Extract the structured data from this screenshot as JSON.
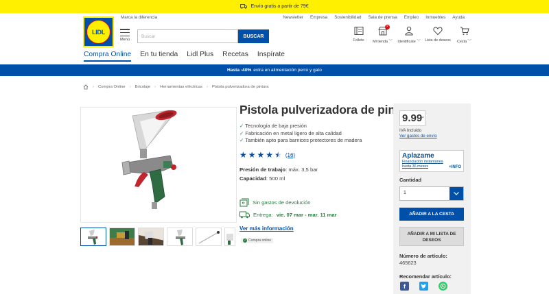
{
  "topbar": {
    "text": "Envío gratis a partir de 79€"
  },
  "utility": {
    "left": "Marca la diferencia",
    "links": [
      "Newsletter",
      "Empresa",
      "Sostenibilidad",
      "Sala de prensa",
      "Empleo",
      "Inmuebles",
      "Ayuda"
    ]
  },
  "logo": {
    "text": "LIDL"
  },
  "menu": {
    "label": "Menú"
  },
  "search": {
    "placeholder": "Buscar",
    "button": "BUSCAR"
  },
  "header_icons": [
    {
      "icon": "folleto-icon",
      "label": "Folleto"
    },
    {
      "icon": "shop-icon",
      "label": "Mi tienda",
      "chevron": true
    },
    {
      "icon": "user-icon",
      "label": "Identifícate",
      "chevron": true
    },
    {
      "icon": "heart-icon",
      "label": "Lista de deseos"
    },
    {
      "icon": "cart-icon",
      "label": "Cesta",
      "chevron": true
    }
  ],
  "nav": [
    "Compra Online",
    "En tu tienda",
    "Lidl Plus",
    "Recetas",
    "Inspírate"
  ],
  "promo": {
    "bold": "Hasta -40%",
    "rest": "extra en alimentación perro y gato"
  },
  "breadcrumbs": [
    "Compra Online",
    "Bricolaje",
    "Herramientas eléctricas",
    "Pistola pulverizadora de pintura"
  ],
  "product": {
    "title": "Pistola pulverizadora de pintura",
    "features": [
      "Tecnología de baja presión",
      "Fabricación en metal ligero de alta calidad",
      "También apto para barnices protectores de madera"
    ],
    "rating_count": "(16)",
    "rating_stars": 4.5,
    "spec1_label": "Presión de trabajo",
    "spec1_value": ": máx. 3,5 bar",
    "spec2_label": "Capacidad",
    "spec2_value": ": 500 ml",
    "returns": "Sin gastos de devolución",
    "delivery_label": "Entrega:",
    "delivery_dates": "vie. 07 mar - mar. 11 mar",
    "more_info": "Ver más información",
    "online_badge": "Compra online"
  },
  "buy": {
    "price": "9.99",
    "price_mark": "*",
    "iva": "IVA Incluido",
    "envio": "Ver gastos de envío",
    "aplazame_brand": "Aplazame",
    "aplazame_text": "Financiación instantánea hasta 36 meses",
    "aplazame_info": "+INFO",
    "qty_label": "Cantidad",
    "qty_value": "1",
    "add_cart": "AÑADIR A LA CESTA",
    "add_wish": "AÑADIR A MI LISTA DE DESEOS",
    "art_label": "Número de artículo:",
    "art_num": "465623",
    "rec_label": "Recomendar artículo:"
  },
  "colors": {
    "brand_blue": "#0050aa",
    "brand_yellow": "#fff000",
    "brand_red": "#e30613",
    "green": "#2a7b3f"
  }
}
